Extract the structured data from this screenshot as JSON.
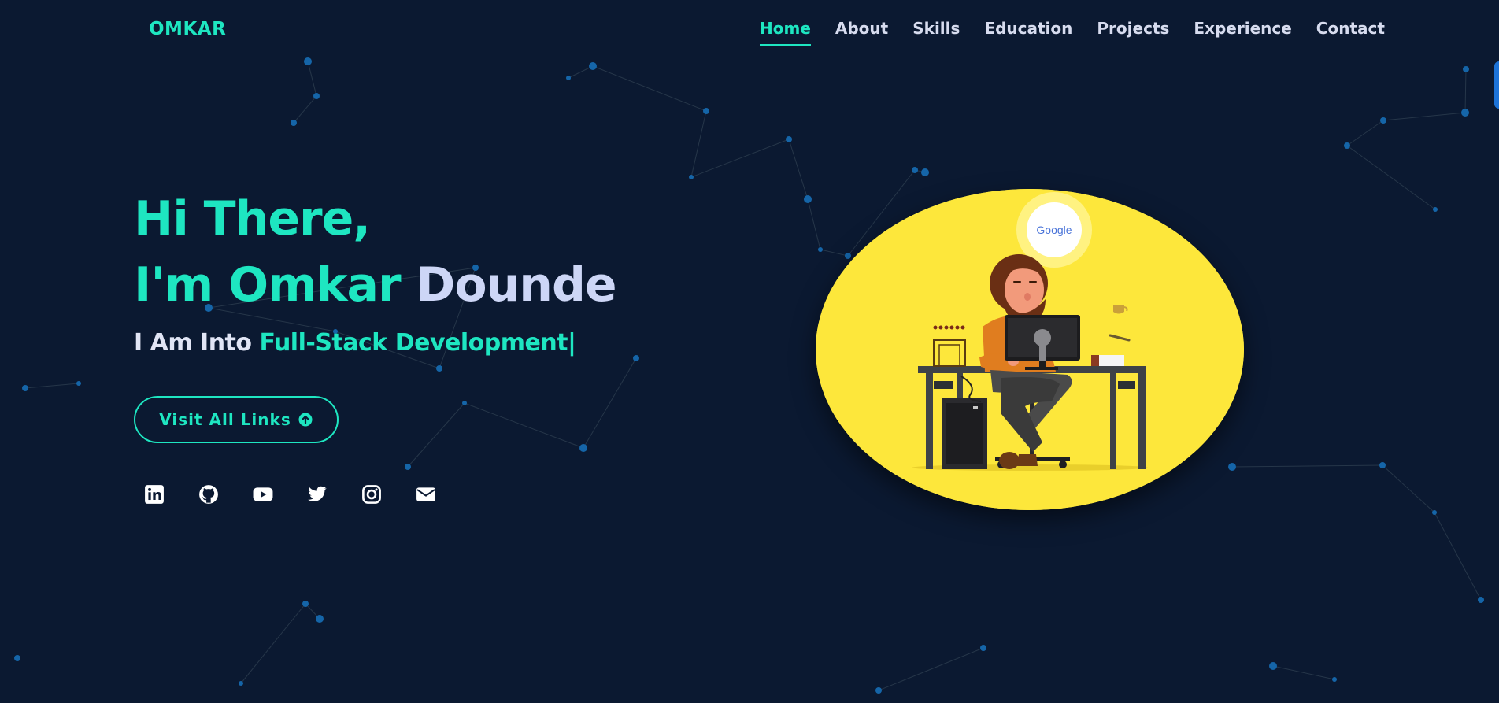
{
  "brand": {
    "logo": "OMKAR"
  },
  "nav": {
    "items": [
      "Home",
      "About",
      "Skills",
      "Education",
      "Projects",
      "Experience",
      "Contact"
    ],
    "active": "Home"
  },
  "hero": {
    "greeting": "Hi There,",
    "intro_prefix": "I'm",
    "first_name": "Omkar",
    "last_name": "Dounde",
    "tagline_prefix": "I Am Into",
    "tagline_highlight": "Full-Stack Development",
    "typing_cursor": "|",
    "cta_label": "Visit All Links",
    "cta_icon": "arrow-up-circle-icon"
  },
  "socials": [
    {
      "name": "linkedin",
      "icon": "linkedin-icon"
    },
    {
      "name": "github",
      "icon": "github-icon"
    },
    {
      "name": "youtube",
      "icon": "youtube-icon"
    },
    {
      "name": "twitter",
      "icon": "twitter-icon"
    },
    {
      "name": "instagram",
      "icon": "instagram-icon"
    },
    {
      "name": "email",
      "icon": "envelope-icon"
    }
  ],
  "illustration": {
    "bubble_text": "Google"
  },
  "colors": {
    "background": "#0b1931",
    "accent": "#1ee6c1",
    "text_light": "#d7dcef",
    "hero_oval": "#fde73b",
    "particle": "#1565a8"
  }
}
